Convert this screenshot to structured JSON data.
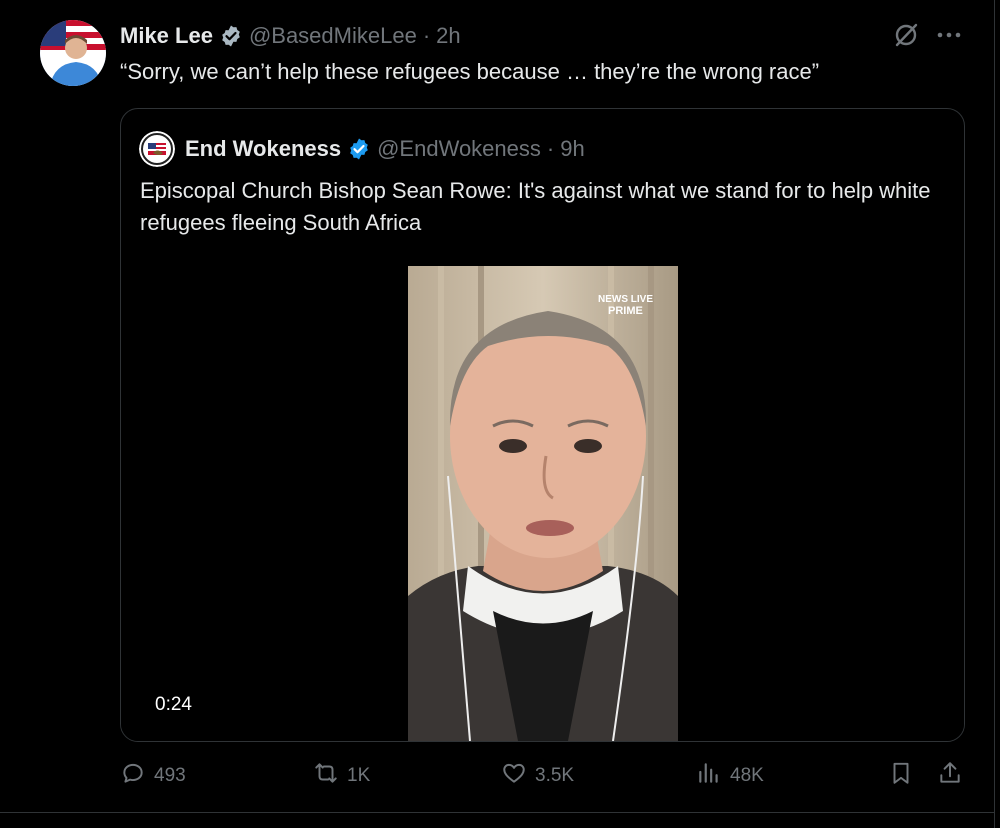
{
  "tweet": {
    "author_name": "Mike Lee",
    "author_handle": "@BasedMikeLee",
    "separator": "·",
    "time": "2h",
    "text": "“Sorry, we can’t help these refugees because … they’re the wrong race”"
  },
  "quoted_tweet": {
    "author_name": "End Wokeness",
    "author_handle": "@EndWokeness",
    "separator": "·",
    "time": "9h",
    "text": "Episcopal Church Bishop Sean Rowe: It's against what we stand for to help white refugees fleeing South Africa",
    "video": {
      "duration": "0:24",
      "watermark_line1": "NEWS LIVE",
      "watermark_line2": "PRIME"
    }
  },
  "actions": {
    "replies": "493",
    "reposts": "1K",
    "likes": "3.5K",
    "views": "48K"
  },
  "icons": {
    "verified": "verified-badge-icon",
    "grok": "grok-icon",
    "more": "more-icon",
    "reply": "reply-icon",
    "repost": "repost-icon",
    "like": "like-icon",
    "views": "views-icon",
    "bookmark": "bookmark-icon",
    "share": "share-icon"
  },
  "colors": {
    "background": "#000000",
    "text": "#e7e9ea",
    "secondary": "#71767b",
    "verified": "#1d9bf0",
    "border": "#2f3336"
  }
}
